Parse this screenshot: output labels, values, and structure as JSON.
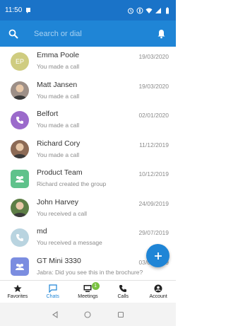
{
  "status_bar": {
    "time": "11:50"
  },
  "search": {
    "placeholder": "Search or dial"
  },
  "conversations": [
    {
      "name": "Emma Poole",
      "subtitle": "You made a call",
      "date": "19/03/2020",
      "avatar": "EP",
      "avatar_color": "#cfcc80"
    },
    {
      "name": "Matt Jansen",
      "subtitle": "You made a call",
      "date": "19/03/2020",
      "avatar": "photo",
      "avatar_color": "#9d8f87"
    },
    {
      "name": "Belfort",
      "subtitle": "You made a call",
      "date": "02/01/2020",
      "avatar": "phone",
      "avatar_color": "#9b6acb"
    },
    {
      "name": "Richard Cory",
      "subtitle": "You made a call",
      "date": "11/12/2019",
      "avatar": "photo",
      "avatar_color": "#8c6a55"
    },
    {
      "name": "Product Team",
      "subtitle": "Richard created the group",
      "date": "10/12/2019",
      "avatar": "group",
      "avatar_color": "#5fc28b"
    },
    {
      "name": "John Harvey",
      "subtitle": "You received a call",
      "date": "24/09/2019",
      "avatar": "photo",
      "avatar_color": "#5d7e46"
    },
    {
      "name": "md",
      "subtitle": "You received a message",
      "date": "29/07/2019",
      "avatar": "phone",
      "avatar_color": "#b9d4e0"
    },
    {
      "name": "GT Mini 3330",
      "subtitle": "Jabra: Did you see this in the brochure?",
      "date": "03/07/2019",
      "avatar": "group",
      "avatar_color": "#7b8de0"
    }
  ],
  "fab": {
    "label": "+"
  },
  "bottom_nav": [
    {
      "label": "Favorites",
      "icon": "star-icon",
      "active": false
    },
    {
      "label": "Chats",
      "icon": "chat-icon",
      "active": true
    },
    {
      "label": "Meetings",
      "icon": "meetings-icon",
      "active": false,
      "badge": "1"
    },
    {
      "label": "Calls",
      "icon": "phone-icon",
      "active": false
    },
    {
      "label": "Account",
      "icon": "account-icon",
      "active": false
    }
  ],
  "colors": {
    "primary": "#1f85d6",
    "status_bar": "#1a73c8",
    "badge": "#7ac142"
  }
}
